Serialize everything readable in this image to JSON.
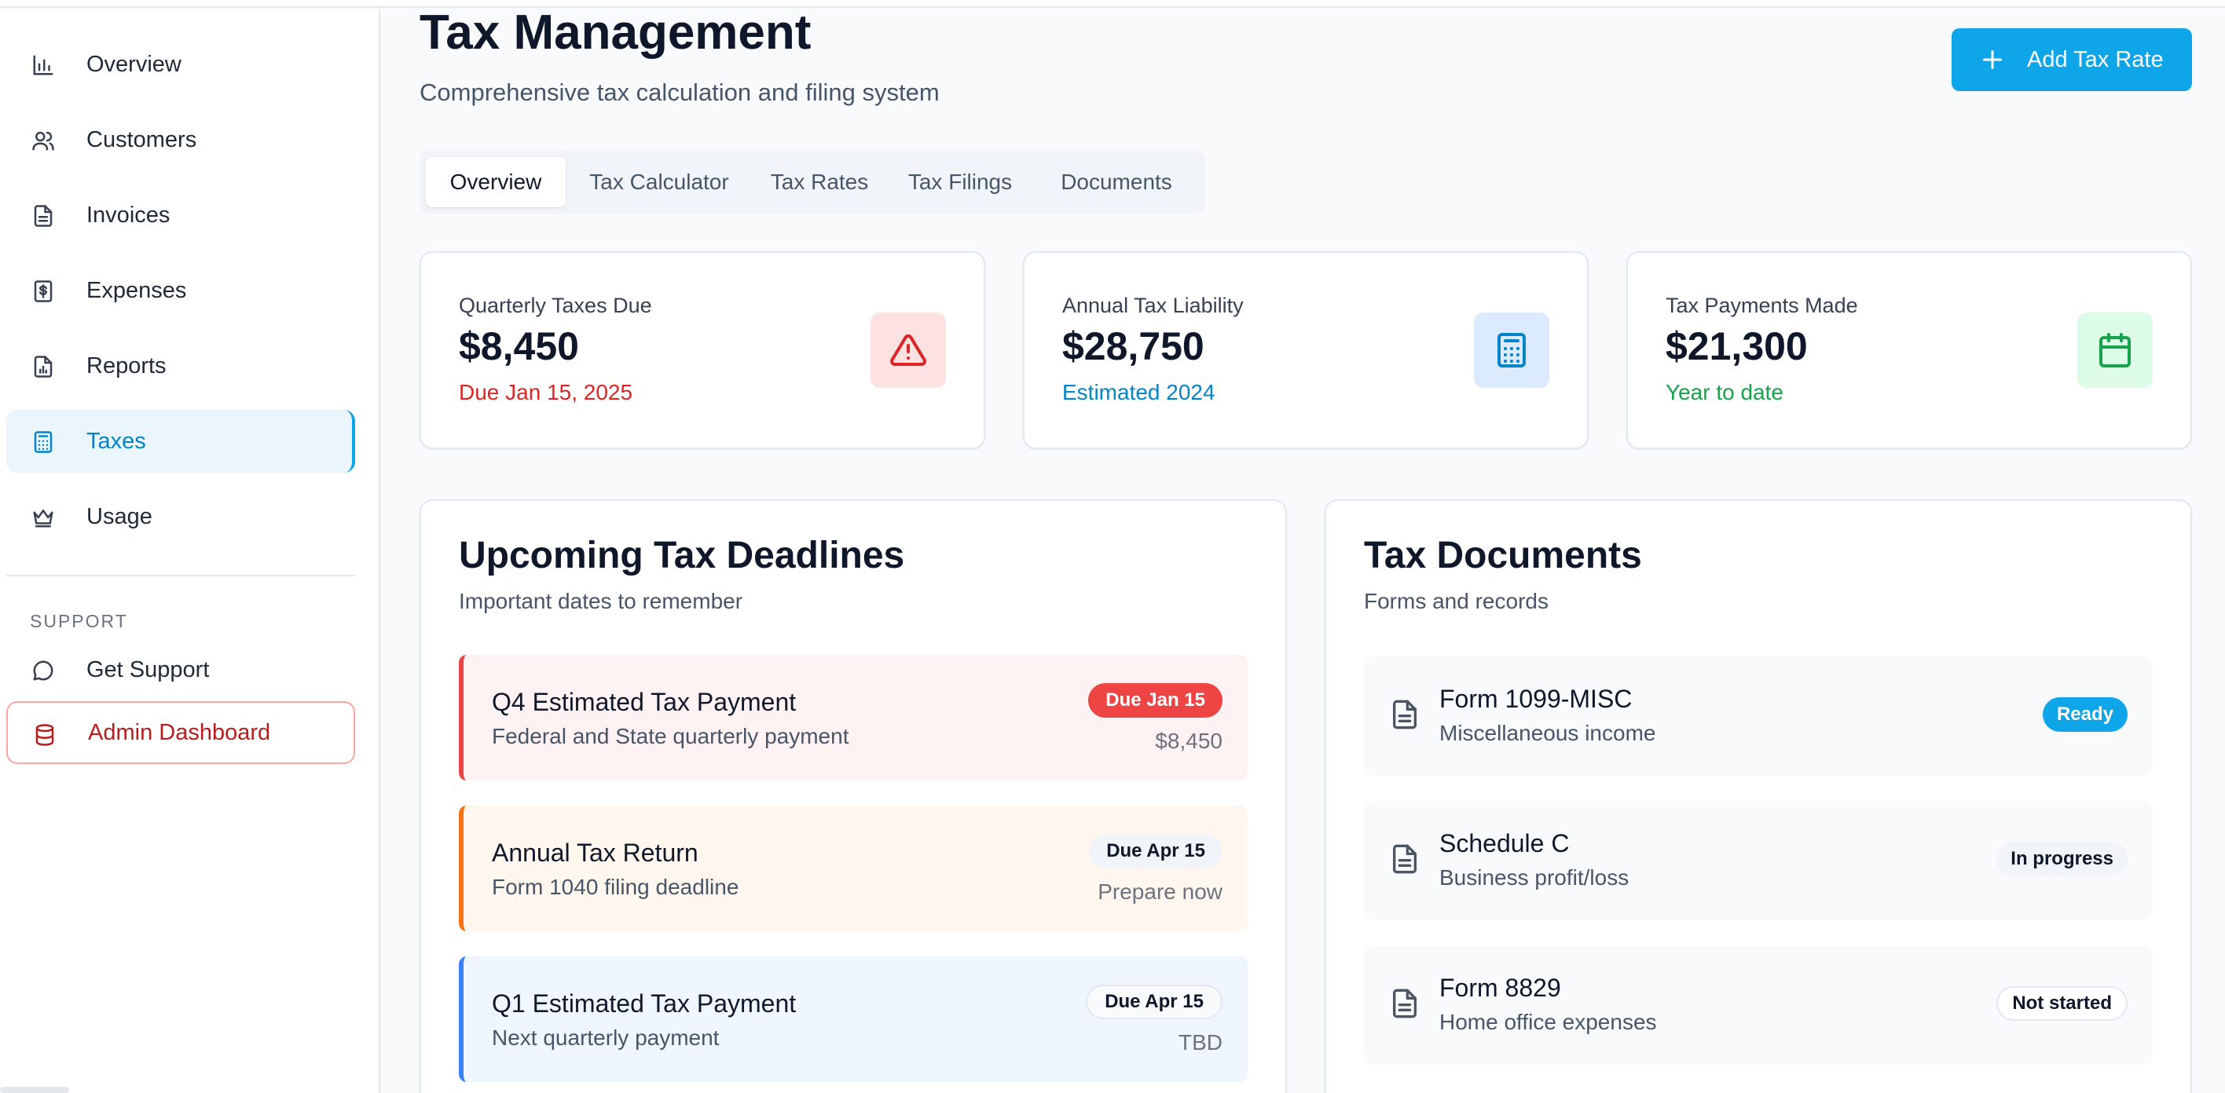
{
  "sidebar": {
    "items": [
      {
        "label": "Overview",
        "icon": "bar-chart-icon"
      },
      {
        "label": "Customers",
        "icon": "users-icon"
      },
      {
        "label": "Invoices",
        "icon": "file-text-icon"
      },
      {
        "label": "Expenses",
        "icon": "receipt-dollar-icon"
      },
      {
        "label": "Reports",
        "icon": "file-chart-icon"
      },
      {
        "label": "Taxes",
        "icon": "calculator-icon",
        "active": true
      },
      {
        "label": "Usage",
        "icon": "crown-icon"
      }
    ],
    "section_label": "SUPPORT",
    "support_items": [
      {
        "label": "Get Support",
        "icon": "message-circle-icon"
      },
      {
        "label": "Admin Dashboard",
        "icon": "database-icon"
      }
    ]
  },
  "header": {
    "title": "Tax Management",
    "subtitle": "Comprehensive tax calculation and filing system",
    "add_button_label": "Add Tax Rate"
  },
  "tabs": [
    {
      "label": "Overview",
      "active": true
    },
    {
      "label": "Tax Calculator"
    },
    {
      "label": "Tax Rates"
    },
    {
      "label": "Tax Filings"
    },
    {
      "label": "Documents"
    }
  ],
  "stats": [
    {
      "label": "Quarterly Taxes Due",
      "value": "$8,450",
      "note": "Due Jan 15, 2025",
      "note_color": "#dc2626",
      "icon": "alert-triangle-icon",
      "icon_color": "#dc2626",
      "icon_bg": "#fee2e2"
    },
    {
      "label": "Annual Tax Liability",
      "value": "$28,750",
      "note": "Estimated 2024",
      "note_color": "#0284c7",
      "icon": "calculator-icon",
      "icon_color": "#0284c7",
      "icon_bg": "#dbeafe"
    },
    {
      "label": "Tax Payments Made",
      "value": "$21,300",
      "note": "Year to date",
      "note_color": "#16a34a",
      "icon": "calendar-icon",
      "icon_color": "#16a34a",
      "icon_bg": "#dcfce7"
    }
  ],
  "deadlines": {
    "title": "Upcoming Tax Deadlines",
    "subtitle": "Important dates to remember",
    "items": [
      {
        "title": "Q4 Estimated Tax Payment",
        "desc": "Federal and State quarterly payment",
        "badge": "Due Jan 15",
        "amount": "$8,450"
      },
      {
        "title": "Annual Tax Return",
        "desc": "Form 1040 filing deadline",
        "badge": "Due Apr 15",
        "amount": "Prepare now"
      },
      {
        "title": "Q1 Estimated Tax Payment",
        "desc": "Next quarterly payment",
        "badge": "Due Apr 15",
        "amount": "TBD"
      }
    ]
  },
  "documents": {
    "title": "Tax Documents",
    "subtitle": "Forms and records",
    "items": [
      {
        "title": "Form 1099-MISC",
        "desc": "Miscellaneous income",
        "status": "Ready"
      },
      {
        "title": "Schedule C",
        "desc": "Business profit/loss",
        "status": "In progress"
      },
      {
        "title": "Form 8829",
        "desc": "Home office expenses",
        "status": "Not started"
      }
    ]
  },
  "colors": {
    "accent": "#0ea5e9",
    "danger": "#dc2626",
    "warning": "#f97316",
    "info": "#3b82f6"
  }
}
